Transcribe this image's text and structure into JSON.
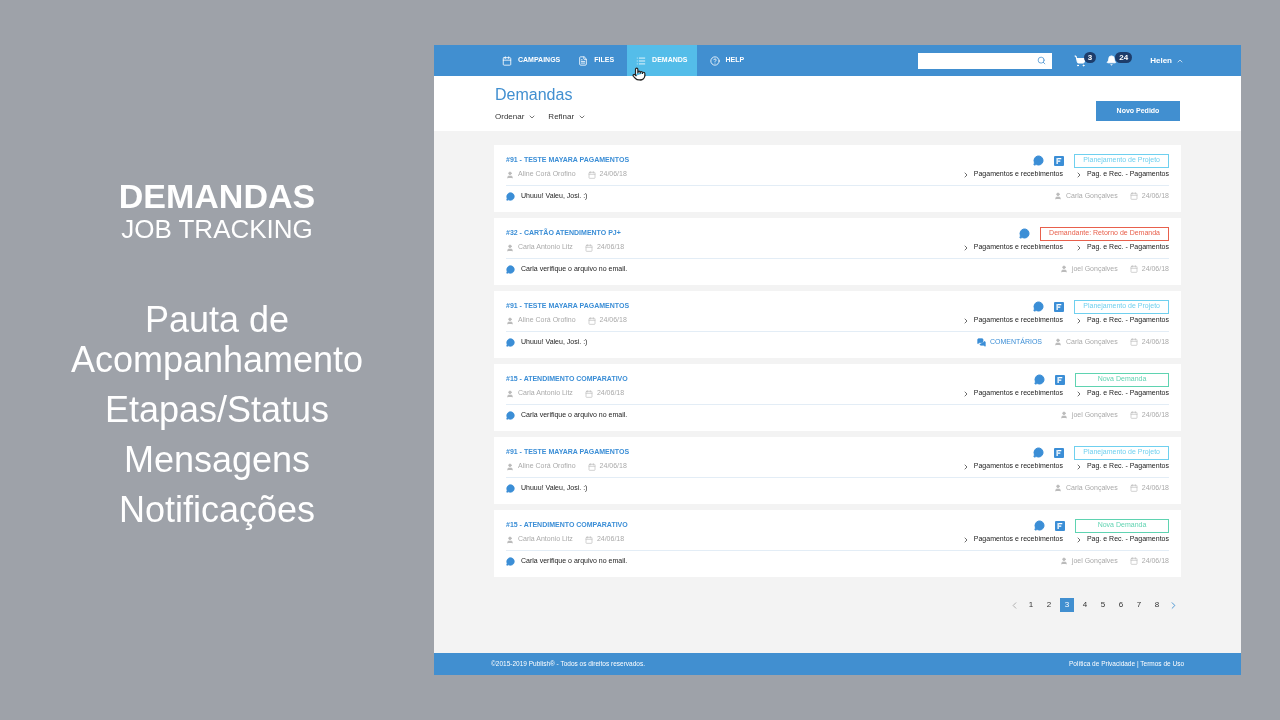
{
  "slide": {
    "heading": "DEMANDAS",
    "subheading": "JOB TRACKING",
    "features": [
      "Pauta de Acompanhamento",
      "Etapas/Status",
      "Mensagens",
      "Notificações"
    ]
  },
  "nav": {
    "items": [
      {
        "label": "CAMPAINGS",
        "kind": "calendar",
        "selected": false
      },
      {
        "label": "FILES",
        "kind": "files",
        "selected": false
      },
      {
        "label": "DEMANDS",
        "kind": "list",
        "selected": true
      },
      {
        "label": "HELP",
        "kind": "help",
        "selected": false
      }
    ],
    "cart_count": "3",
    "notification_count": "24",
    "user": "Helen"
  },
  "header": {
    "title": "Demandas",
    "filters": [
      "Ordenar",
      "Refinar"
    ],
    "new_button": "Novo Pedido"
  },
  "cards": [
    {
      "title": "#91 - TESTE MAYARA PAGAMENTOS",
      "author": "Aline Corá Orofino",
      "date": "24/06/18",
      "flag": true,
      "status": {
        "label": "Planejamento de Projeto",
        "color": "#6fd0ef"
      },
      "categories": [
        "Pagamentos e recebimentos",
        "Pag. e Rec. - Pagamentos"
      ],
      "message": "Uhuuu! Valeu, Josi. :)",
      "reply_author": "Carla Gonçalves",
      "reply_date": "24/06/18"
    },
    {
      "title": "#32 - CARTÃO ATENDIMENTO PJ+",
      "author": "Carla Antonio Litz",
      "date": "24/06/18",
      "flag": false,
      "status": {
        "label": "Demandante: Retorno de Demanda",
        "color": "#e8604c"
      },
      "categories": [
        "Pagamentos e recebimentos",
        "Pag. e Rec. - Pagamentos"
      ],
      "message": "Carla verifique o arquivo no email.",
      "reply_author": "joel Gonçalves",
      "reply_date": "24/06/18"
    },
    {
      "title": "#91 - TESTE MAYARA PAGAMENTOS",
      "author": "Aline Corá Orofino",
      "date": "24/06/18",
      "flag": true,
      "status": {
        "label": "Planejamento de Projeto",
        "color": "#6fd0ef"
      },
      "categories": [
        "Pagamentos e recebimentos",
        "Pag. e Rec. - Pagamentos"
      ],
      "message": "Uhuuu! Valeu, Josi. :)",
      "comments_link": "COMENTÁRIOS",
      "reply_author": "Carla Gonçalves",
      "reply_date": "24/06/18"
    },
    {
      "title": "#15 - ATENDIMENTO COMPARATIVO",
      "author": "Carla Antonio Litz",
      "date": "24/06/18",
      "flag": true,
      "status": {
        "label": "Nova Demanda",
        "color": "#5fd3b1"
      },
      "categories": [
        "Pagamentos e recebimentos",
        "Pag. e Rec. - Pagamentos"
      ],
      "message": "Carla verifique o arquivo no email.",
      "reply_author": "joel Gonçalves",
      "reply_date": "24/06/18"
    },
    {
      "title": "#91 - TESTE MAYARA PAGAMENTOS",
      "author": "Aline Corá Orofino",
      "date": "24/06/18",
      "flag": true,
      "status": {
        "label": "Planejamento de Projeto",
        "color": "#6fd0ef"
      },
      "categories": [
        "Pagamentos e recebimentos",
        "Pag. e Rec. - Pagamentos"
      ],
      "message": "Uhuuu! Valeu, Josi. :)",
      "reply_author": "Carla Gonçalves",
      "reply_date": "24/06/18"
    },
    {
      "title": "#15 - ATENDIMENTO COMPARATIVO",
      "author": "Carla Antonio Litz",
      "date": "24/06/18",
      "flag": true,
      "status": {
        "label": "Nova Demanda",
        "color": "#5fd3b1"
      },
      "categories": [
        "Pagamentos e recebimentos",
        "Pag. e Rec. - Pagamentos"
      ],
      "message": "Carla verifique o arquivo no email.",
      "reply_author": "joel Gonçalves",
      "reply_date": "24/06/18"
    }
  ],
  "pagination": [
    {
      "label": "1",
      "selected": false
    },
    {
      "label": "2",
      "selected": false
    },
    {
      "label": "3",
      "selected": true
    },
    {
      "label": "4",
      "selected": false
    },
    {
      "label": "5",
      "selected": false
    },
    {
      "label": "6",
      "selected": false
    },
    {
      "label": "7",
      "selected": false
    },
    {
      "label": "8",
      "selected": false
    }
  ],
  "footer": {
    "copyright": "©2015-2019 Publish® - Todos os direitos reservados.",
    "links": "Política de Privacidade | Termos de Uso"
  }
}
